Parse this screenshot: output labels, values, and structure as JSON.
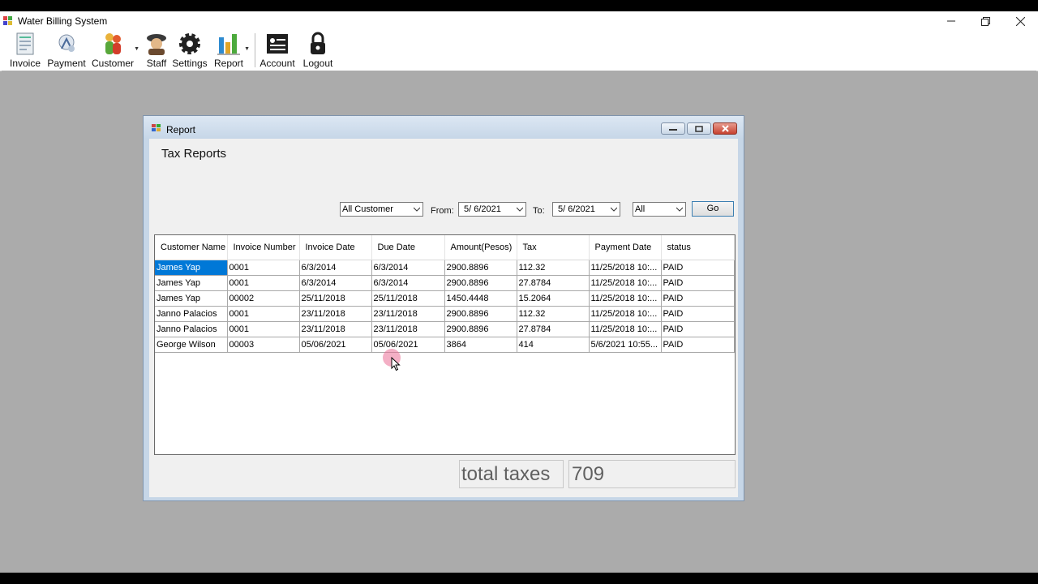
{
  "app": {
    "title": "Water Billing System"
  },
  "toolbar": [
    {
      "label": "Invoice",
      "icon": "invoice-icon"
    },
    {
      "label": "Payment",
      "icon": "payment-icon"
    },
    {
      "label": "Customer",
      "icon": "customer-icon"
    },
    {
      "label": "Staff",
      "icon": "staff-icon"
    },
    {
      "label": "Settings",
      "icon": "settings-icon"
    },
    {
      "label": "Report",
      "icon": "report-icon"
    },
    {
      "label": "Account",
      "icon": "account-icon"
    },
    {
      "label": "Logout",
      "icon": "logout-icon"
    }
  ],
  "report": {
    "window_title": "Report",
    "heading": "Tax Reports",
    "filters": {
      "customer": "All Customer",
      "from_label": "From:",
      "from_date": "5/ 6/2021",
      "to_label": "To:",
      "to_date": "5/ 6/2021",
      "status": "All",
      "go_label": "Go"
    },
    "grid": {
      "columns": [
        "Customer Name",
        "Invoice Number",
        "Invoice Date",
        "Due Date",
        "Amount(Pesos)",
        "Tax",
        "Payment Date",
        "status"
      ],
      "rows": [
        [
          "James Yap",
          "0001",
          "6/3/2014",
          "6/3/2014",
          "2900.8896",
          "112.32",
          "11/25/2018 10:...",
          "PAID"
        ],
        [
          "James Yap",
          "0001",
          "6/3/2014",
          "6/3/2014",
          "2900.8896",
          "27.8784",
          "11/25/2018 10:...",
          "PAID"
        ],
        [
          "James Yap",
          "00002",
          "25/11/2018",
          "25/11/2018",
          "1450.4448",
          "15.2064",
          "11/25/2018 10:...",
          "PAID"
        ],
        [
          "Janno Palacios",
          "0001",
          "23/11/2018",
          "23/11/2018",
          "2900.8896",
          "112.32",
          "11/25/2018 10:...",
          "PAID"
        ],
        [
          "Janno Palacios",
          "0001",
          "23/11/2018",
          "23/11/2018",
          "2900.8896",
          "27.8784",
          "11/25/2018 10:...",
          "PAID"
        ],
        [
          "George Wilson",
          "00003",
          "05/06/2021",
          "05/06/2021",
          "3864",
          "414",
          "5/6/2021 10:55...",
          "PAID"
        ]
      ]
    },
    "total_label": "total taxes",
    "total_value": "709"
  },
  "colors": {
    "selection": "#0078d7",
    "mdi_background": "#ababab"
  }
}
